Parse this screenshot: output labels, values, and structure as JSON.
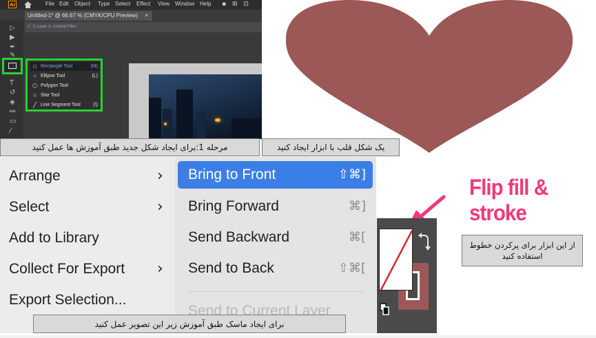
{
  "illustrator": {
    "logo": "Ai",
    "menu": [
      "File",
      "Edit",
      "Object",
      "Type",
      "Select",
      "Effect",
      "View",
      "Window",
      "Help"
    ],
    "menu_right_icons": "▪ ⊞ ⊡",
    "document_tab": "Untitled-1* @ 66.67 % (CMYK/CPU Preview)",
    "tab_close": "×",
    "breadcrumb": "⊏ ⊐  Layer 1   <Linked File>",
    "flyout": [
      {
        "icon": "□",
        "label": "Rectangle Tool",
        "shortcut": "(M)"
      },
      {
        "icon": "○",
        "label": "Ellipse Tool",
        "shortcut": "(L)"
      },
      {
        "icon": "⬡",
        "label": "Polygon Tool",
        "shortcut": ""
      },
      {
        "icon": "☆",
        "label": "Star Tool",
        "shortcut": ""
      },
      {
        "icon": "╱",
        "label": "Line Segment Tool",
        "shortcut": "(\\)"
      }
    ]
  },
  "captions": {
    "step1": "مرحله 1:برای ایجاد شکل جدید طبق آموزش ها عمل کنید",
    "heart": "یک شکل قلب با ابزار ایجاد کنید",
    "mask": "برای ایجاد ماسک طبق آموزش زیر این تصویر عمل کنید",
    "stroke": "از این ابزار برای پرکردن خطوط استفاده کنید"
  },
  "heart_color": "#9b5856",
  "arrange_menu": {
    "left_items": [
      {
        "label": "Arrange",
        "chevron": "›"
      },
      {
        "label": "Select",
        "chevron": "›"
      },
      {
        "label": "Add to Library",
        "chevron": ""
      },
      {
        "label": "Collect For Export",
        "chevron": "›"
      },
      {
        "label": "Export Selection...",
        "chevron": ""
      }
    ],
    "right_items": [
      {
        "label": "Bring to Front",
        "shortcut": "⇧⌘]"
      },
      {
        "label": "Bring Forward",
        "shortcut": "⌘]"
      },
      {
        "label": "Send Backward",
        "shortcut": "⌘["
      },
      {
        "label": "Send to Back",
        "shortcut": "⇧⌘["
      }
    ],
    "faded_item": "Send to Current Layer",
    "selection_color": "#3b7fe6"
  },
  "flip": {
    "title": "Flip fill & stroke",
    "title_color": "#f03a78",
    "stroke_color": "#9b5856"
  }
}
